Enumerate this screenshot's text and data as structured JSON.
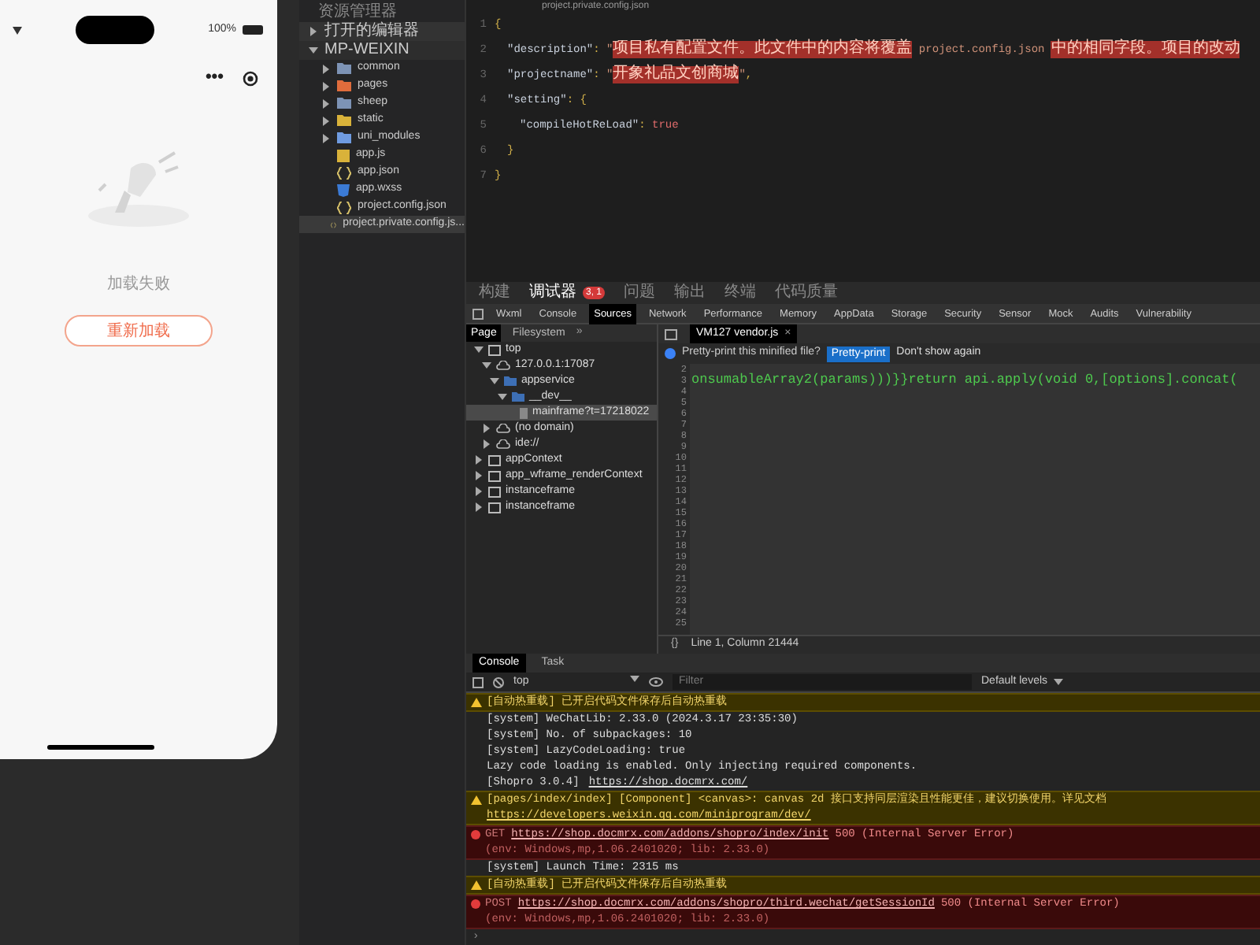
{
  "phone": {
    "battery": "100%",
    "capsule_more": "•••",
    "message": "加载失败",
    "reload_button": "重新加载"
  },
  "explorer": {
    "title": "资源管理器",
    "sections": [
      {
        "label": "打开的编辑器",
        "expanded": false
      },
      {
        "label": "MP-WEIXIN",
        "expanded": true
      }
    ],
    "items": [
      {
        "name": "common",
        "kind": "folder",
        "color": "#7d93b5",
        "selected": false
      },
      {
        "name": "pages",
        "kind": "folder",
        "color": "#e06c3c",
        "selected": false
      },
      {
        "name": "sheep",
        "kind": "folder",
        "color": "#7d93b5",
        "selected": false
      },
      {
        "name": "static",
        "kind": "folder",
        "color": "#d9b23a",
        "selected": false
      },
      {
        "name": "uni_modules",
        "kind": "folder",
        "color": "#6f9be0",
        "selected": false
      },
      {
        "name": "app.js",
        "kind": "js",
        "selected": false
      },
      {
        "name": "app.json",
        "kind": "json",
        "selected": false
      },
      {
        "name": "app.wxss",
        "kind": "css",
        "selected": false
      },
      {
        "name": "project.config.json",
        "kind": "json",
        "selected": false
      },
      {
        "name": "project.private.config.js...",
        "kind": "json",
        "selected": true
      }
    ]
  },
  "editor": {
    "breadcrumb": "project.private.config.json",
    "lines": [
      {
        "number": "1",
        "kind": "outer",
        "tokens": [
          {
            "kind": "punct",
            "text": "{"
          }
        ]
      },
      {
        "number": "2",
        "kind": "member",
        "tokens": [
          {
            "kind": "key",
            "text": "\"description\""
          },
          {
            "kind": "punct",
            "text": ": "
          },
          {
            "kind": "string",
            "text": "\""
          },
          {
            "kind": "highlight",
            "text": "项目私有配置文件。此文件中的内容将覆盖"
          },
          {
            "kind": "string",
            "text": " project.config.json "
          },
          {
            "kind": "highlight",
            "text": "中的相同字段。项目的改动"
          }
        ]
      },
      {
        "number": "3",
        "kind": "member",
        "tokens": [
          {
            "kind": "key",
            "text": "\"projectname\""
          },
          {
            "kind": "punct",
            "text": ": "
          },
          {
            "kind": "string",
            "text": "\""
          },
          {
            "kind": "highlight",
            "text": "开象礼品文创商城"
          },
          {
            "kind": "string",
            "text": "\""
          },
          {
            "kind": "punct",
            "text": ","
          }
        ]
      },
      {
        "number": "4",
        "kind": "member",
        "tokens": [
          {
            "kind": "key",
            "text": "\"setting\""
          },
          {
            "kind": "punct",
            "text": ": {"
          }
        ]
      },
      {
        "number": "5",
        "kind": "nested",
        "tokens": [
          {
            "kind": "key",
            "text": "\"compileHotReLoad\""
          },
          {
            "kind": "punct",
            "text": ": "
          },
          {
            "kind": "bool",
            "text": "true"
          }
        ]
      },
      {
        "number": "6",
        "kind": "member",
        "tokens": [
          {
            "kind": "punct",
            "text": "}"
          }
        ]
      },
      {
        "number": "7",
        "kind": "outer",
        "tokens": [
          {
            "kind": "punct",
            "text": "}"
          }
        ]
      }
    ]
  },
  "devtools": {
    "top_tabs": [
      {
        "label": "构建",
        "selected": false
      },
      {
        "label": "调试器",
        "selected": true,
        "badge": "3, 1"
      },
      {
        "label": "问题",
        "selected": false
      },
      {
        "label": "输出",
        "selected": false
      },
      {
        "label": "终端",
        "selected": false
      },
      {
        "label": "代码质量",
        "selected": false
      }
    ],
    "panel_tabs": [
      {
        "label": "Wxml",
        "selected": false
      },
      {
        "label": "Console",
        "selected": false
      },
      {
        "label": "Sources",
        "selected": true
      },
      {
        "label": "Network",
        "selected": false
      },
      {
        "label": "Performance",
        "selected": false
      },
      {
        "label": "Memory",
        "selected": false
      },
      {
        "label": "AppData",
        "selected": false
      },
      {
        "label": "Storage",
        "selected": false
      },
      {
        "label": "Security",
        "selected": false
      },
      {
        "label": "Sensor",
        "selected": false
      },
      {
        "label": "Mock",
        "selected": false
      },
      {
        "label": "Audits",
        "selected": false
      },
      {
        "label": "Vulnerability",
        "selected": false
      }
    ],
    "sources": {
      "nav_tabs": [
        {
          "label": "Page",
          "selected": true
        },
        {
          "label": "Filesystem",
          "selected": false
        }
      ],
      "nav_more": "»",
      "tree": [
        {
          "label": "top",
          "kind": "frame",
          "expanded": true,
          "selected": false,
          "children": [
            {
              "label": "127.0.0.1:17087",
              "kind": "domain",
              "expanded": true,
              "selected": false,
              "children": [
                {
                  "label": "appservice",
                  "kind": "folder",
                  "expanded": true,
                  "selected": false,
                  "children": [
                    {
                      "label": "__dev__",
                      "kind": "folder",
                      "expanded": true,
                      "selected": false,
                      "children": [
                        {
                          "label": "mainframe?t=17218022",
                          "kind": "file",
                          "selected": true
                        }
                      ]
                    }
                  ]
                }
              ]
            },
            {
              "label": "(no domain)",
              "kind": "domain",
              "expanded": false,
              "selected": false
            },
            {
              "label": "ide://",
              "kind": "domain",
              "expanded": false,
              "selected": false
            }
          ]
        },
        {
          "label": "appContext",
          "kind": "frame",
          "expanded": false,
          "selected": false
        },
        {
          "label": "app_wframe_renderContext",
          "kind": "frame",
          "expanded": false,
          "selected": false
        },
        {
          "label": "instanceframe",
          "kind": "frame",
          "expanded": false,
          "selected": false
        },
        {
          "label": "instanceframe",
          "kind": "frame",
          "expanded": false,
          "selected": false
        }
      ],
      "file_tab": {
        "label": "VM127 vendor.js",
        "close": "×"
      },
      "pretty_print": {
        "message": "Pretty-print this minified file?",
        "button": "Pretty-print",
        "dismiss": "Don't show again"
      },
      "line_numbers": [
        "2",
        "3",
        "4",
        "5",
        "6",
        "7",
        "8",
        "9",
        "10",
        "11",
        "12",
        "13",
        "14",
        "15",
        "16",
        "17",
        "18",
        "19",
        "20",
        "21",
        "22",
        "23",
        "24",
        "25"
      ],
      "code": "onsumableArray2(params)))}}return api.apply(void 0,[options].concat(",
      "format_button": "{}",
      "status": "Line 1, Column 21444"
    },
    "console": {
      "tabs": [
        {
          "label": "Console",
          "selected": true
        },
        {
          "label": "Task",
          "selected": false
        }
      ],
      "context": "top",
      "filter_placeholder": "Filter",
      "levels": "Default levels",
      "messages": [
        {
          "kind": "warn",
          "text": "[自动热重载] 已开启代码文件保存后自动热重载"
        },
        {
          "kind": "log",
          "text": "[system] WeChatLib: 2.33.0 (2024.3.17 23:35:30)"
        },
        {
          "kind": "log",
          "text": "[system] No. of subpackages: 10"
        },
        {
          "kind": "log",
          "text": "[system] LazyCodeLoading: true"
        },
        {
          "kind": "log",
          "text": "Lazy code loading is enabled. Only injecting required components."
        },
        {
          "kind": "log",
          "text": "[Shopro 3.0.4]",
          "link": "https://shop.docmrx.com/"
        },
        {
          "kind": "warn",
          "text": "[pages/index/index] [Component] <canvas>: canvas 2d 接口支持同层渲染且性能更佳，建议切换使用。详见文档",
          "link": "https://developers.weixin.qq.com/miniprogram/dev/"
        },
        {
          "kind": "error",
          "method": "GET",
          "link": "https://shop.docmrx.com/addons/shopro/index/init",
          "text": "500 (Internal Server Error)",
          "detail": "(env: Windows,mp,1.06.2401020; lib: 2.33.0)"
        },
        {
          "kind": "log",
          "text": "[system] Launch Time: 2315 ms"
        },
        {
          "kind": "warn",
          "text": "[自动热重载] 已开启代码文件保存后自动热重载"
        },
        {
          "kind": "error",
          "method": "POST",
          "link": "https://shop.docmrx.com/addons/shopro/third.wechat/getSessionId",
          "text": "500 (Internal Server Error)",
          "detail": "(env: Windows,mp,1.06.2401020; lib: 2.33.0)"
        }
      ],
      "prompt": "›"
    }
  }
}
